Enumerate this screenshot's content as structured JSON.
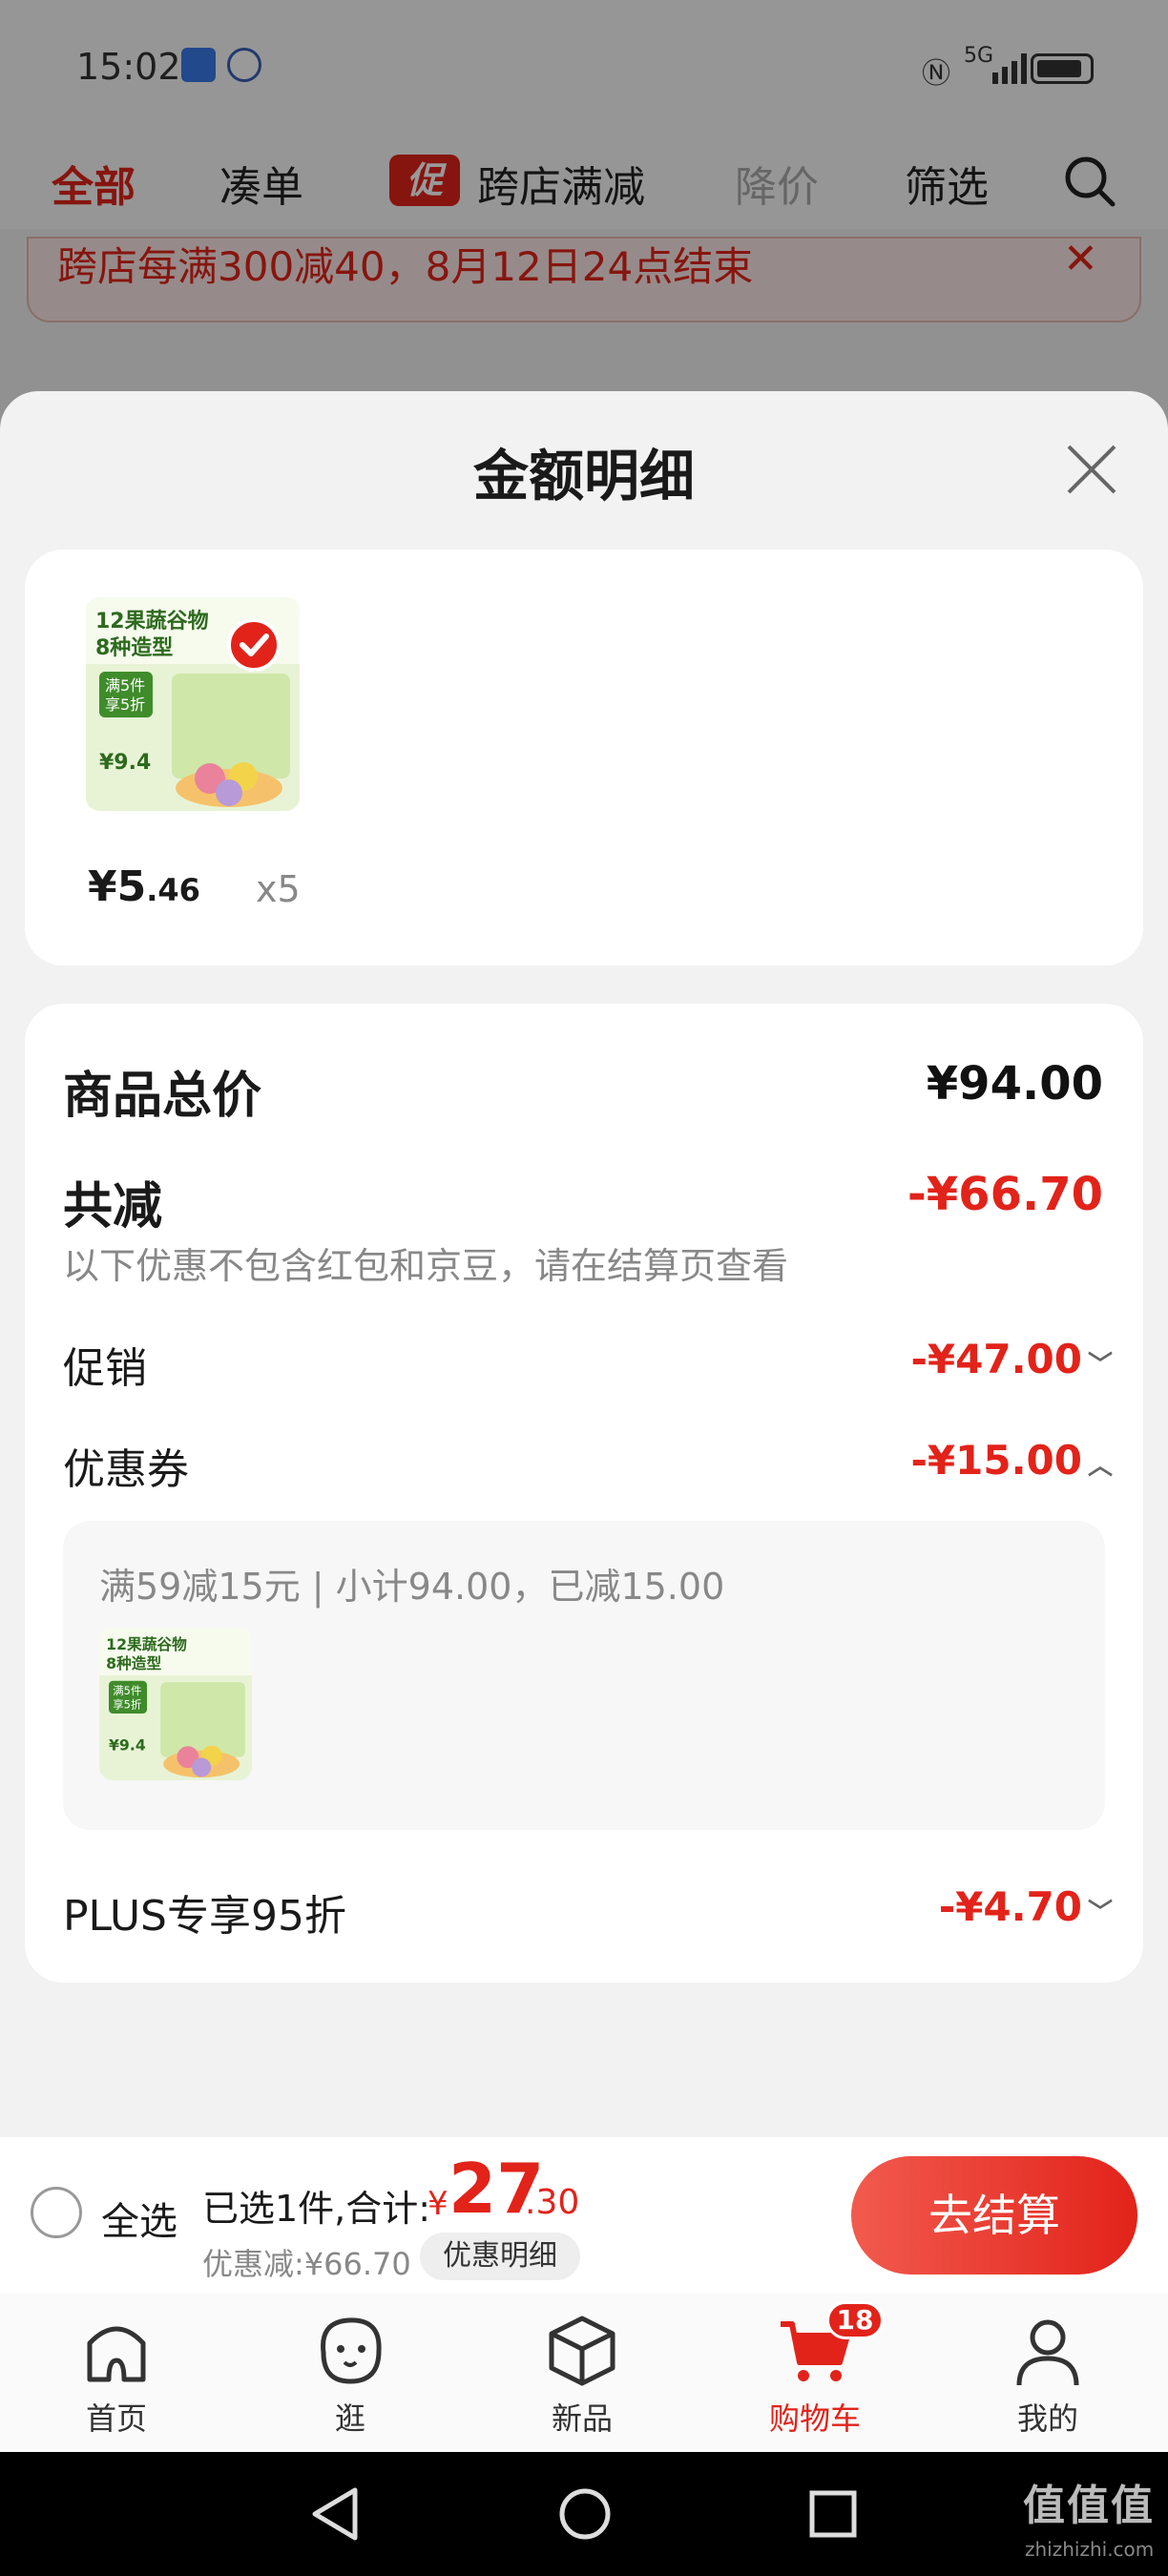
{
  "status_bar": {
    "time": "15:02",
    "network": "5G"
  },
  "tabs": {
    "all": "全部",
    "cou_dan": "凑单",
    "promo_badge": "促",
    "cross_store": "跨店满减",
    "price_drop": "降价",
    "filter": "筛选"
  },
  "banner": {
    "text": "跨店每满300减40，8月12日24点结束"
  },
  "sheet": {
    "title": "金额明细"
  },
  "item": {
    "price_int": "¥5",
    "price_dec": ".46",
    "quantity": "x5"
  },
  "product_image_text": {
    "line1": "12果蔬谷物",
    "line2": "8种造型",
    "promo1": "满5件",
    "promo2": "享5折",
    "price": "¥9.4"
  },
  "summary": {
    "total_label": "商品总价",
    "total_value": "¥94.00",
    "discount_label": "共减",
    "discount_value": "-¥66.70",
    "discount_note": "以下优惠不包含红包和京豆，请在结算页查看",
    "promo_label": "促销",
    "promo_value": "-¥47.00",
    "coupon_label": "优惠券",
    "coupon_value": "-¥15.00",
    "coupon_desc": "满59减15元 | 小计94.00，已减15.00",
    "plus_label": "PLUS专享95折",
    "plus_value": "-¥4.70"
  },
  "checkout": {
    "select_all": "全选",
    "selected_text": "已选1件,合计:",
    "yen": "¥",
    "amount_int": "27",
    "amount_dec": ".30",
    "saved_text": "优惠减:¥66.70",
    "detail_button": "优惠明细",
    "checkout_button": "去结算"
  },
  "nav": {
    "home": "首页",
    "browse": "逛",
    "new": "新品",
    "cart": "购物车",
    "cart_badge": "18",
    "mine": "我的"
  },
  "watermark": {
    "main": "值值值",
    "sub": "zhizhizhi.com"
  },
  "colors": {
    "accent": "#e2231a",
    "background": "#f2f2f2"
  }
}
